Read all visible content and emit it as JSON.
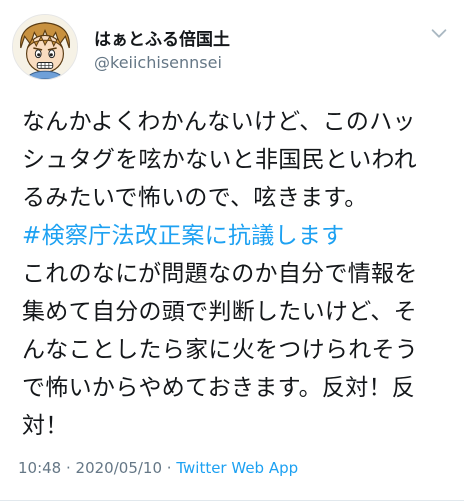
{
  "user": {
    "display_name": "はぁとふる倍国土",
    "handle": "@keiichisennsei",
    "avatar_icon": "cartoon-avatar-icon"
  },
  "menu": {
    "icon": "chevron-down-icon"
  },
  "tweet": {
    "lines": [
      "なんかよくわかんないけど、このハッ",
      "シュタグを呟かないと非国民といわれ",
      "るみたいで怖いので、呟きます。",
      "#検察庁法改正案に抗議します",
      "これのなにが問題なのか自分で情報を",
      "集めて自分の頭で判断したいけど、そ",
      "んなことしたら家に火をつけられそう",
      "で怖いからやめておきます。反対！反",
      "対！"
    ],
    "hashtag_line_index": 3
  },
  "meta": {
    "time": "10:48",
    "sep1": " · ",
    "date": "2020/05/10",
    "sep2": " · ",
    "source": "Twitter Web App"
  },
  "colors": {
    "link": "#1da1f2",
    "muted": "#657786",
    "text": "#14171a"
  }
}
